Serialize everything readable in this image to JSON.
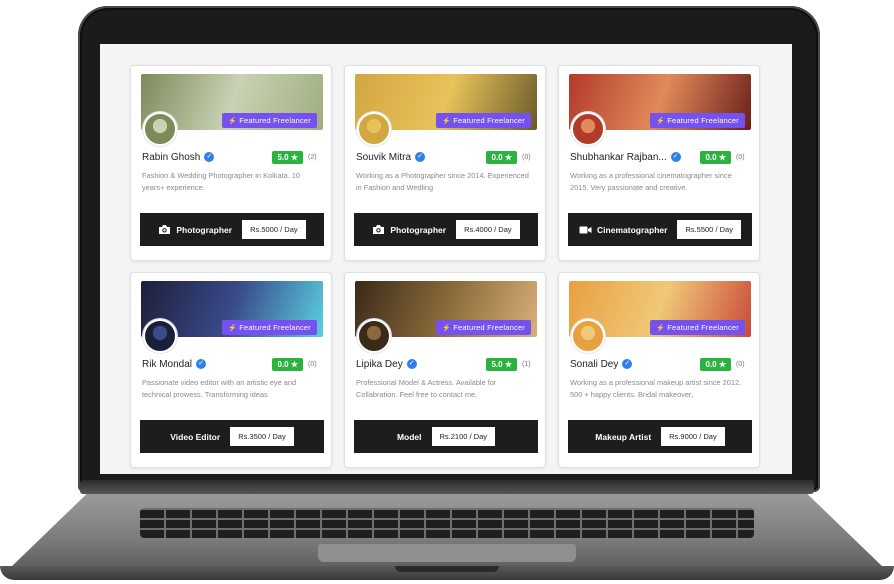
{
  "badge_label": "Featured Freelancer",
  "cards": [
    {
      "name": "Rabin Ghosh",
      "rating": "5.0",
      "reviews": "(2)",
      "description": "Fashion & Wedding Photographer in Kolkata. 10 years+ experience.",
      "role": "Photographer",
      "role_icon": "camera-icon",
      "price": "Rs.5000 / Day",
      "cover_colors": [
        "#7d8a5a",
        "#c8d2b4",
        "#9fae7f"
      ]
    },
    {
      "name": "Souvik Mitra",
      "rating": "0.0",
      "reviews": "(0)",
      "description": "Working as a Photographer since 2014. Experienced in Fashion and Wedling",
      "role": "Photographer",
      "role_icon": "camera-icon",
      "price": "Rs.4000 / Day",
      "cover_colors": [
        "#d2a640",
        "#e8c35a",
        "#6a5a2a"
      ]
    },
    {
      "name": "Shubhankar Rajban...",
      "rating": "0.0",
      "reviews": "(0)",
      "description": "Working as a professional cinematographer since 2015. Very passionate and creative.",
      "role": "Cinematographer",
      "role_icon": "video-camera-icon",
      "price": "Rs.5500 / Day",
      "cover_colors": [
        "#b23a2a",
        "#e08a5a",
        "#6b1f1a"
      ]
    },
    {
      "name": "Rik Mondal",
      "rating": "0.0",
      "reviews": "(0)",
      "description": "Passionate video editor with an artistic eye and technical prowess. Transforming ideas",
      "role": "Video Editor",
      "role_icon": "",
      "price": "Rs.3500 / Day",
      "cover_colors": [
        "#1c1f3a",
        "#3a4a8a",
        "#5ad0e0"
      ]
    },
    {
      "name": "Lipika Dey",
      "rating": "5.0",
      "reviews": "(1)",
      "description": "Professional Model & Actress. Available for Collabration. Feel free to contact me.",
      "role": "Model",
      "role_icon": "",
      "price": "Rs.2100 / Day",
      "cover_colors": [
        "#3a2a1a",
        "#8a6a3a",
        "#d8b07a"
      ]
    },
    {
      "name": "Sonali Dey",
      "rating": "0.0",
      "reviews": "(0)",
      "description": "Working as a professional makeup artist since 2012. 500 + happy clients. Bridal makeover,",
      "role": "Makeup Artist",
      "role_icon": "",
      "price": "Rs.9000 / Day",
      "cover_colors": [
        "#e8a040",
        "#f0c878",
        "#c84a3a"
      ]
    }
  ]
}
